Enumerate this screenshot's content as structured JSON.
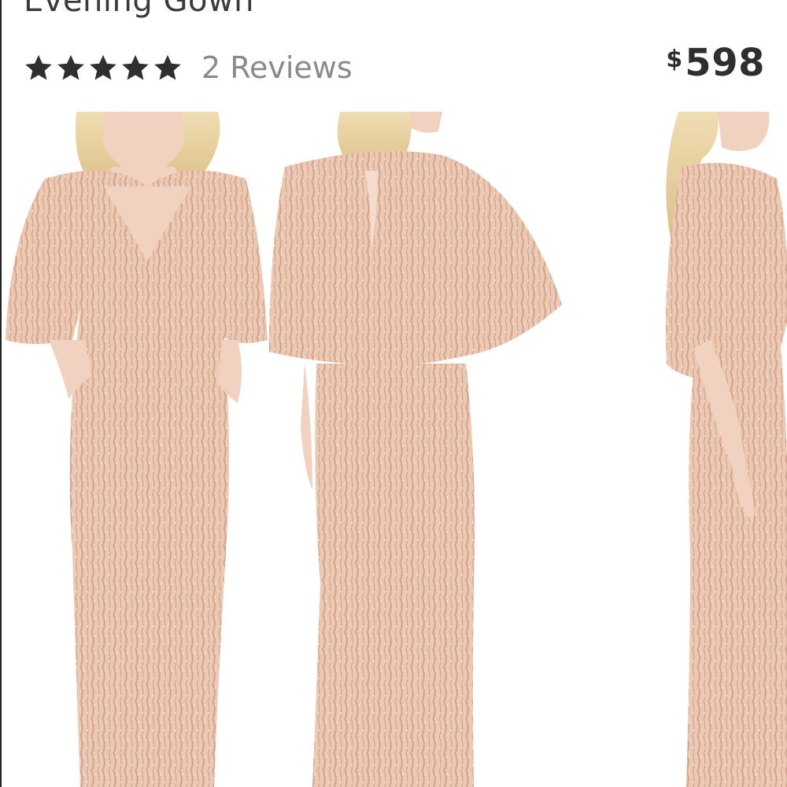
{
  "product": {
    "title": "Evening Gown",
    "rating_stars": 5,
    "reviews_label": "2 Reviews",
    "price_currency": "$",
    "price_amount": "598"
  },
  "icons": {
    "star": "star-icon"
  },
  "colors": {
    "text_primary": "#2f2f2f",
    "text_secondary": "#8a8a8a",
    "star": "#2f2f2f",
    "gown_base": "#ecc9b3",
    "gown_sequin": "#d6a48c",
    "hair": "#e8d3a4",
    "skin": "#f1d2c0"
  }
}
